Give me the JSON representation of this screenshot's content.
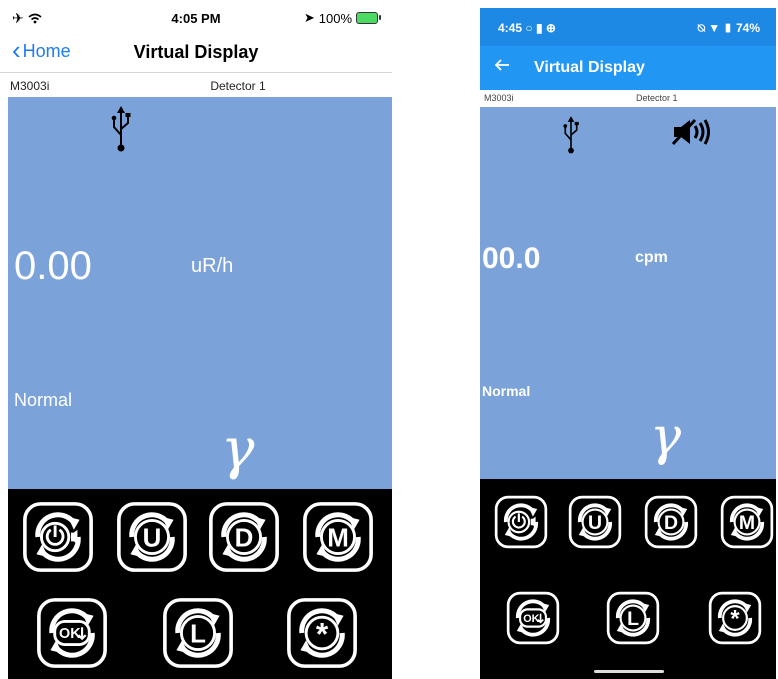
{
  "colors": {
    "display_bg": "#7ba2d9",
    "ios_accent": "#1e7cf0",
    "android_appbar": "#2196f3",
    "android_statusbar": "#1e88e5",
    "keypad_bg": "#000000"
  },
  "ios": {
    "status_bar": {
      "time": "4:05 PM",
      "battery": "100%",
      "left_icons": "airplane-icon, wifi-icon"
    },
    "nav": {
      "back_label": "Home",
      "title": "Virtual Display"
    },
    "info": {
      "model": "M3003i",
      "detector": "Detector 1"
    },
    "display": {
      "reading": "0.00",
      "unit": "uR/h",
      "status": "Normal",
      "radiation_symbol": "γ",
      "icons": [
        "usb-icon"
      ]
    },
    "keypad": {
      "row1": [
        "power-audio",
        "U",
        "D",
        "M"
      ],
      "row2": [
        "OK",
        "L",
        "*"
      ]
    }
  },
  "android": {
    "status_bar": {
      "time": "4:45",
      "battery": "74%"
    },
    "nav": {
      "title": "Virtual Display"
    },
    "info": {
      "model": "M3003i",
      "detector": "Detector 1"
    },
    "display": {
      "reading": "00.0",
      "unit": "cpm",
      "status": "Normal",
      "radiation_symbol": "γ",
      "icons": [
        "usb-icon",
        "speaker-muted-icon"
      ]
    },
    "keypad": {
      "row1": [
        "power-audio",
        "U",
        "D",
        "M"
      ],
      "row2": [
        "OK",
        "L",
        "*"
      ]
    }
  }
}
